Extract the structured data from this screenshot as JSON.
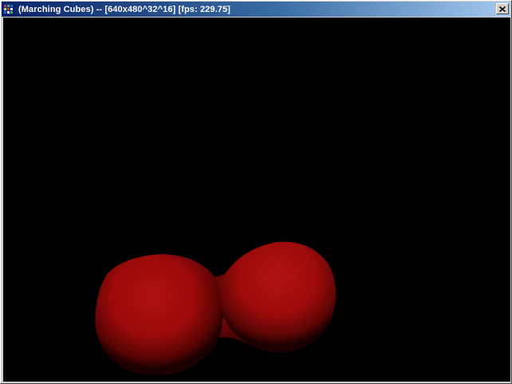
{
  "window": {
    "title": "(Marching Cubes) -- [640x480^32^16] [fps: 229.75]"
  },
  "icons": {
    "app": "opengl-app-icon",
    "close": "close-icon"
  },
  "colors": {
    "titlebar_start": "#0a246a",
    "titlebar_end": "#a6caf0",
    "background": "#000000",
    "blob": "#a00a0a"
  }
}
